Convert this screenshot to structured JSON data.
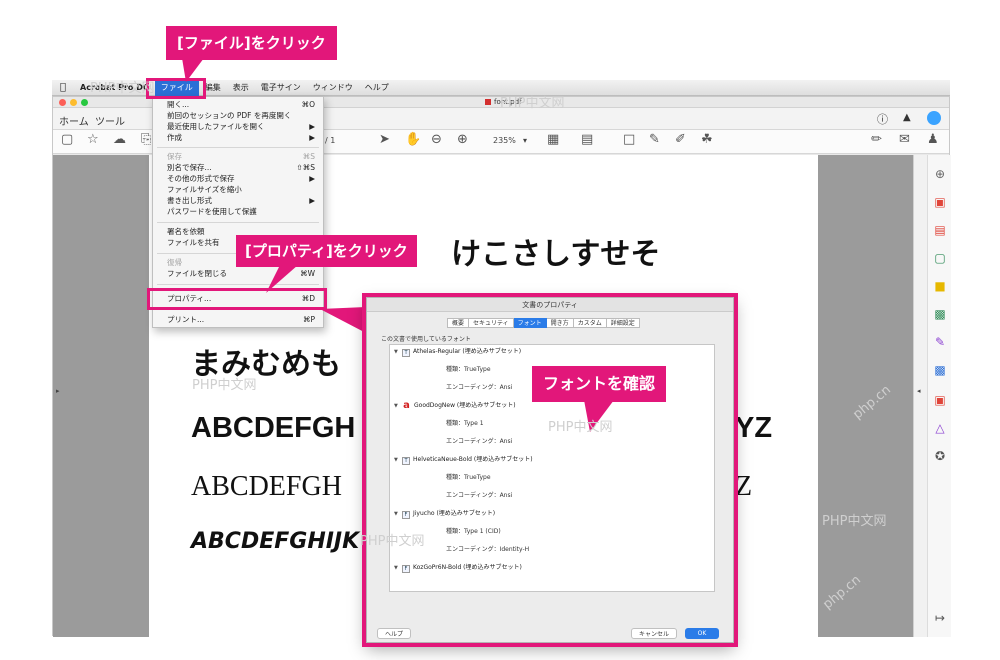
{
  "menubar": {
    "app": "Acrobat Pro DC",
    "items": [
      "ファイル",
      "編集",
      "表示",
      "電子サイン",
      "ウィンドウ",
      "ヘルプ"
    ]
  },
  "window": {
    "doc_title": "font.pdf",
    "tabs": [
      "ホーム",
      "ツール"
    ],
    "page_counter": "/ 1",
    "zoom": "235%"
  },
  "file_menu": {
    "items": [
      {
        "label": "開く...",
        "shortcut": "⌘O"
      },
      {
        "label": "前回のセッションの PDF を再度開く",
        "shortcut": ""
      },
      {
        "label": "最近使用したファイルを開く",
        "shortcut": "▶"
      },
      {
        "label": "作成",
        "shortcut": "▶"
      },
      {
        "label": "保存",
        "shortcut": "⌘S",
        "disabled": true
      },
      {
        "label": "別名で保存...",
        "shortcut": "⇧⌘S"
      },
      {
        "label": "その他の形式で保存",
        "shortcut": "▶"
      },
      {
        "label": "ファイルサイズを縮小",
        "shortcut": ""
      },
      {
        "label": "書き出し形式",
        "shortcut": "▶"
      },
      {
        "label": "パスワードを使用して保護",
        "shortcut": ""
      },
      {
        "label": "署名を依頼",
        "shortcut": ""
      },
      {
        "label": "ファイルを共有",
        "shortcut": ""
      },
      {
        "label": "復帰",
        "shortcut": "",
        "disabled": true
      },
      {
        "label": "ファイルを閉じる",
        "shortcut": "⌘W"
      },
      {
        "label": "プロパティ...",
        "shortcut": "⌘D"
      },
      {
        "label": "プリント...",
        "shortcut": "⌘P"
      }
    ]
  },
  "pdf_text": {
    "line1": "けこさしすせそ",
    "line3": "まみむめも",
    "line4": "ABCDEFGH",
    "line4_end": "YZ",
    "line5": "ABCDEFGH",
    "line5_end": "Z",
    "line6": "ABCDEFGHIJK"
  },
  "callouts": {
    "file": "[ファイル]をクリック",
    "properties": "[プロパティ]をクリック",
    "fonts": "フォントを確認"
  },
  "dialog": {
    "title": "文書のプロパティ",
    "tabs": [
      "概要",
      "セキュリティ",
      "フォント",
      "開き方",
      "カスタム",
      "詳細設定"
    ],
    "active_tab": "フォント",
    "list_label": "この文書で使用しているフォント",
    "fonts": [
      {
        "name": "Athelas-Regular (埋め込みサブセット)",
        "type": "種類：TrueType",
        "encoding": "エンコーディング：Ansi"
      },
      {
        "name": "GoodDogNew (埋め込みサブセット)",
        "type": "種類：Type 1",
        "encoding": "エンコーディング：Ansi"
      },
      {
        "name": "HelveticaNeue-Bold (埋め込みサブセット)",
        "type": "種類：TrueType",
        "encoding": "エンコーディング：Ansi"
      },
      {
        "name": "Jiyucho (埋め込みサブセット)",
        "type": "種類：Type 1 (CID)",
        "encoding": "エンコーディング：Identity-H"
      },
      {
        "name": "KozGoPr6N-Bold (埋め込みサブセット)",
        "type": "",
        "encoding": ""
      }
    ],
    "help_button": "ヘルプ",
    "cancel_button": "キャンセル",
    "ok_button": "OK"
  },
  "watermarks": [
    "PHP中文网",
    "php.cn"
  ],
  "colors": {
    "accent_magenta": "#e2177a",
    "mac_blue": "#2b7ce8"
  }
}
